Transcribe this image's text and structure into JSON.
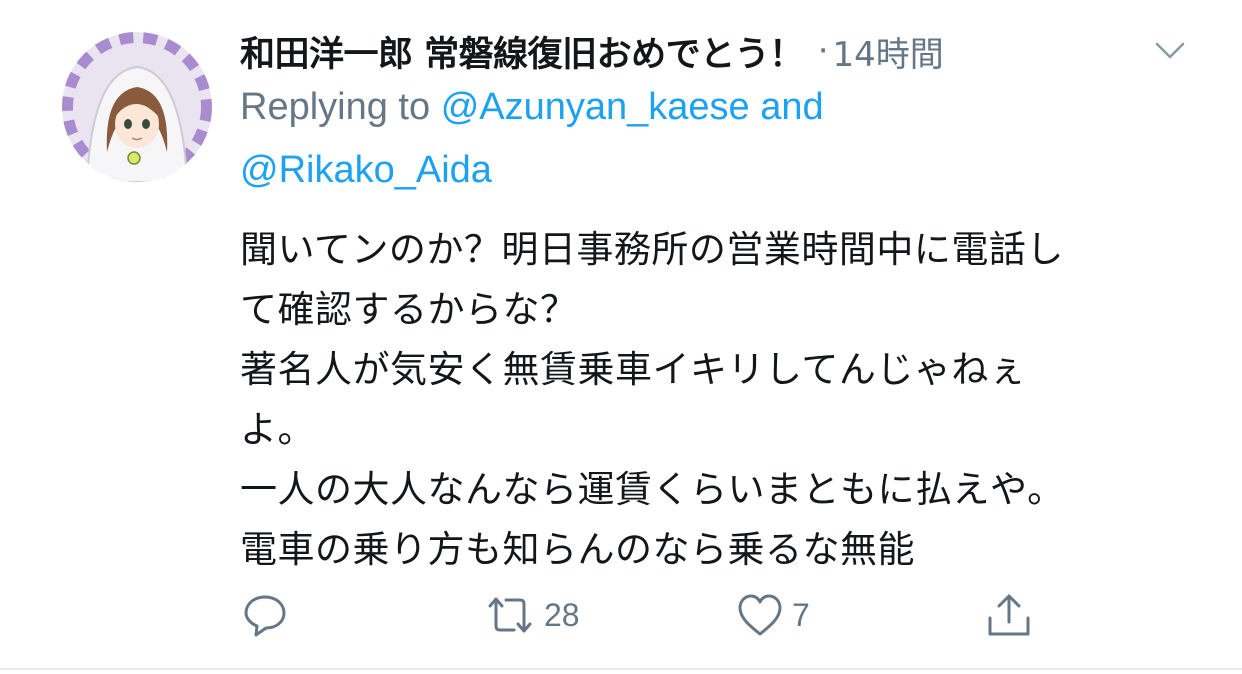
{
  "tweet": {
    "display_name": "和田洋一郎 常磐線復旧おめでとう！",
    "separator": "·",
    "timestamp": "14時間",
    "reply": {
      "prefix": "Replying to",
      "mention1": "@Azunyan_kaese",
      "conjunction": "and",
      "mention2": "@Rikako_Aida"
    },
    "body_lines": [
      "聞いてンのか？明日事務所の営業時間中に電話し",
      "て確認するからな？",
      "著名人が気安く無賃乗車イキリしてんじゃねぇ",
      "よ。",
      "一人の大人なんなら運賃くらいまともに払えや。",
      "電車の乗り方も知らんのなら乗るな無能"
    ],
    "actions": {
      "reply_icon": "reply-bubble-icon",
      "retweet_icon": "retweet-icon",
      "retweet_count": "28",
      "like_icon": "heart-icon",
      "like_count": "7",
      "share_icon": "share-icon"
    }
  },
  "colors": {
    "text": "#14171a",
    "secondary": "#657786",
    "link": "#1da1f2",
    "divider": "#e6ecf0"
  }
}
